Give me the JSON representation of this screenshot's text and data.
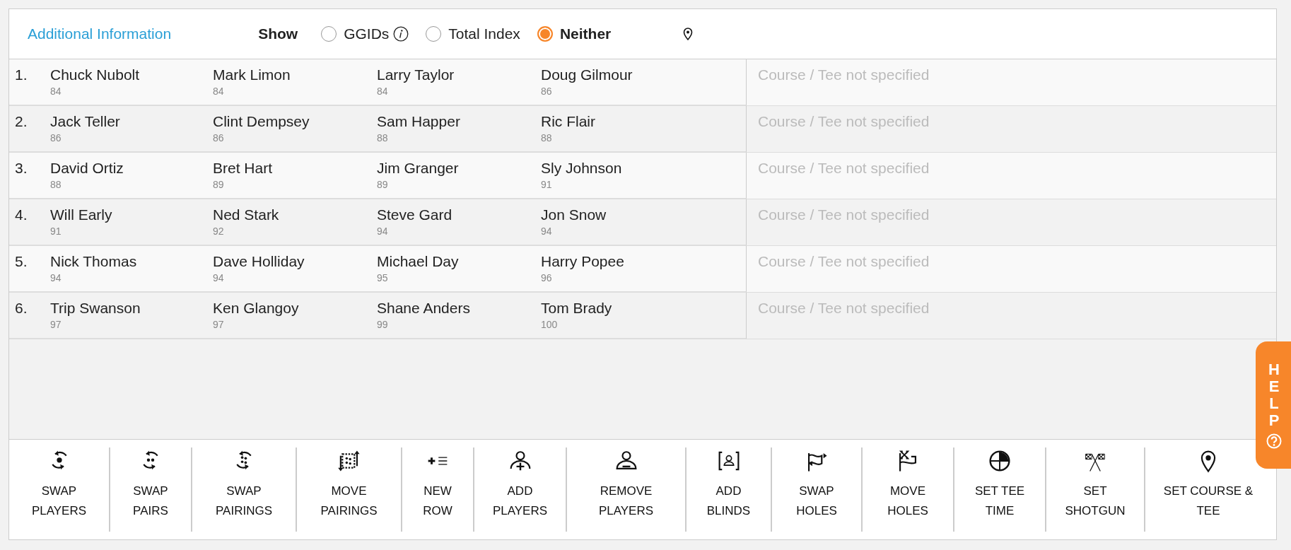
{
  "header": {
    "link": "Additional Information",
    "show_label": "Show",
    "options": [
      {
        "label": "GGIDs",
        "selected": false,
        "info": true
      },
      {
        "label": "Total Index",
        "selected": false,
        "info": false
      },
      {
        "label": "Neither",
        "selected": true,
        "info": false
      }
    ]
  },
  "rows": [
    {
      "number": "1.",
      "players": [
        {
          "name": "Chuck Nubolt",
          "score": "84"
        },
        {
          "name": "Mark Limon",
          "score": "84"
        },
        {
          "name": "Larry Taylor",
          "score": "84"
        },
        {
          "name": "Doug Gilmour",
          "score": "86"
        }
      ],
      "course": "Course / Tee not specified"
    },
    {
      "number": "2.",
      "players": [
        {
          "name": "Jack Teller",
          "score": "86"
        },
        {
          "name": "Clint Dempsey",
          "score": "86"
        },
        {
          "name": "Sam Happer",
          "score": "88"
        },
        {
          "name": "Ric Flair",
          "score": "88"
        }
      ],
      "course": "Course / Tee not specified"
    },
    {
      "number": "3.",
      "players": [
        {
          "name": "David Ortiz",
          "score": "88"
        },
        {
          "name": "Bret Hart",
          "score": "89"
        },
        {
          "name": "Jim Granger",
          "score": "89"
        },
        {
          "name": "Sly Johnson",
          "score": "91"
        }
      ],
      "course": "Course / Tee not specified"
    },
    {
      "number": "4.",
      "players": [
        {
          "name": "Will Early",
          "score": "91"
        },
        {
          "name": "Ned Stark",
          "score": "92"
        },
        {
          "name": "Steve Gard",
          "score": "94"
        },
        {
          "name": "Jon Snow",
          "score": "94"
        }
      ],
      "course": "Course / Tee not specified"
    },
    {
      "number": "5.",
      "players": [
        {
          "name": "Nick Thomas",
          "score": "94"
        },
        {
          "name": "Dave Holliday",
          "score": "94"
        },
        {
          "name": "Michael Day",
          "score": "95"
        },
        {
          "name": "Harry Popee",
          "score": "96"
        }
      ],
      "course": "Course / Tee not specified"
    },
    {
      "number": "6.",
      "players": [
        {
          "name": "Trip Swanson",
          "score": "97"
        },
        {
          "name": "Ken Glangoy",
          "score": "97"
        },
        {
          "name": "Shane Anders",
          "score": "99"
        },
        {
          "name": "Tom Brady",
          "score": "100"
        }
      ],
      "course": "Course / Tee not specified"
    }
  ],
  "tools": [
    {
      "label": [
        "SWAP",
        "PLAYERS"
      ]
    },
    {
      "label": [
        "SWAP",
        "PAIRS"
      ]
    },
    {
      "label": [
        "SWAP",
        "PAIRINGS"
      ]
    },
    {
      "label": [
        "MOVE",
        "PAIRINGS"
      ]
    },
    {
      "label": [
        "NEW",
        "ROW"
      ]
    },
    {
      "label": [
        "ADD",
        "PLAYERS"
      ]
    },
    {
      "label": [
        "REMOVE",
        "PLAYERS"
      ]
    },
    {
      "label": [
        "ADD",
        "BLINDS"
      ]
    },
    {
      "label": [
        "SWAP",
        "HOLES"
      ]
    },
    {
      "label": [
        "MOVE",
        "HOLES"
      ]
    },
    {
      "label": [
        "SET TEE",
        "TIME"
      ]
    },
    {
      "label": [
        "SET",
        "SHOTGUN"
      ]
    },
    {
      "label": [
        "SET COURSE &",
        "TEE"
      ]
    }
  ],
  "help": {
    "label": "HELP"
  }
}
